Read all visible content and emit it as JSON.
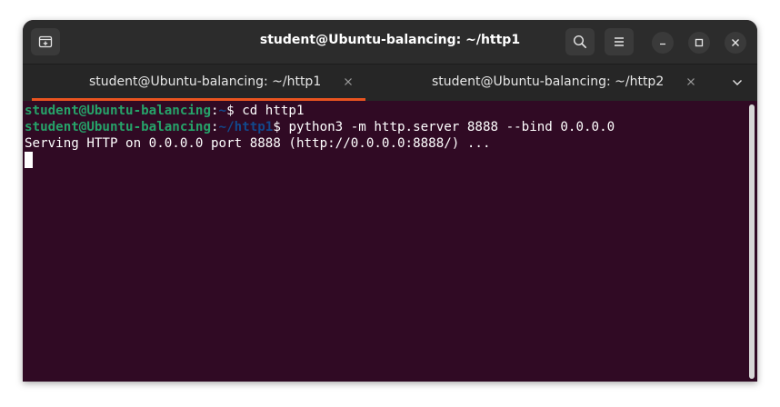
{
  "window": {
    "title": "student@Ubuntu-balancing: ~/http1"
  },
  "header": {
    "new_tab_icon": "new-tab-icon",
    "search_icon": "search-icon",
    "menu_icon": "hamburger-menu-icon",
    "minimize_icon": "minimize-icon",
    "maximize_icon": "maximize-icon",
    "close_icon": "close-icon"
  },
  "tabs": [
    {
      "label": "student@Ubuntu-balancing: ~/http1",
      "active": true
    },
    {
      "label": "student@Ubuntu-balancing: ~/http2",
      "active": false
    }
  ],
  "colors": {
    "terminal_bg": "#300a24",
    "prompt_user": "#26a269",
    "prompt_path": "#12488b",
    "accent": "#e95420"
  },
  "terminal": {
    "lines": [
      {
        "user": "student@Ubuntu-balancing",
        "sep": ":",
        "path": "~",
        "prompt": "$ ",
        "command": "cd http1"
      },
      {
        "user": "student@Ubuntu-balancing",
        "sep": ":",
        "path": "~/http1",
        "prompt": "$ ",
        "command": "python3 -m http.server 8888 --bind 0.0.0.0"
      },
      {
        "output": "Serving HTTP on 0.0.0.0 port 8888 (http://0.0.0.0:8888/) ..."
      }
    ]
  }
}
